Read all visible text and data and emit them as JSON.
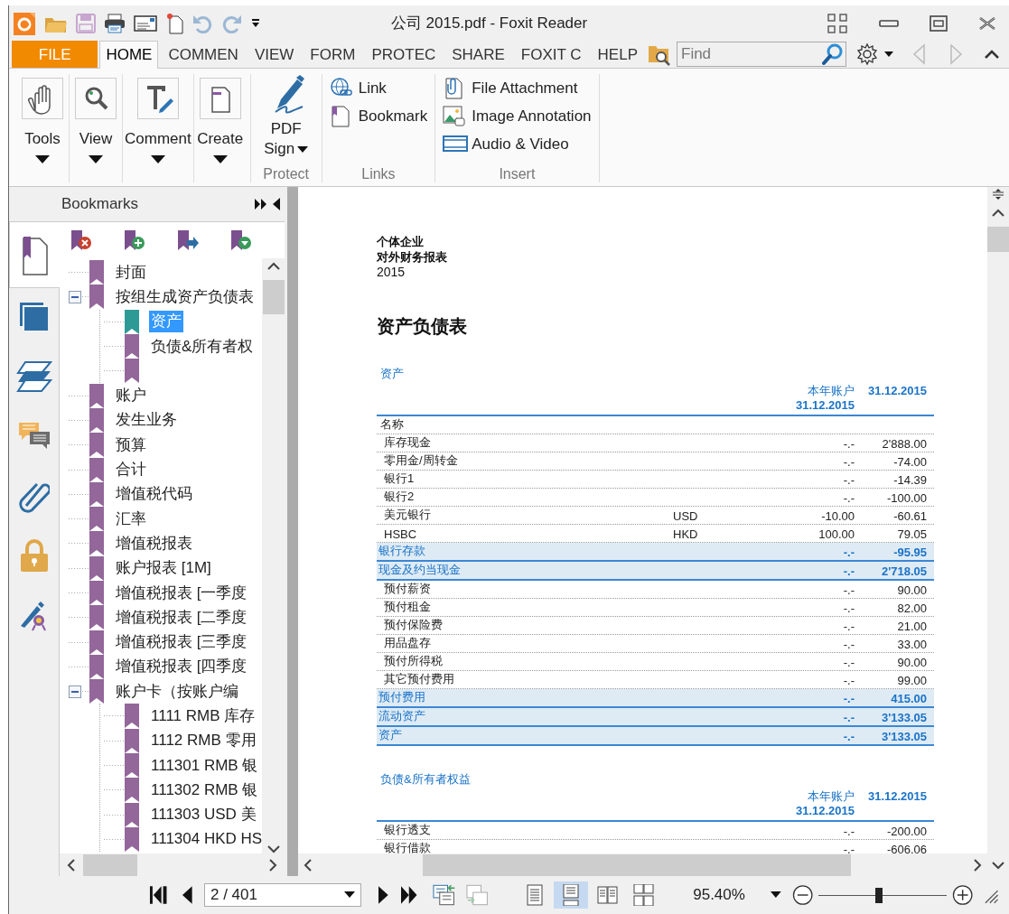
{
  "window": {
    "title": "公司 2015.pdf - Foxit Reader"
  },
  "menu_tabs": [
    {
      "label": "FILE",
      "kind": "file",
      "selected": false
    },
    {
      "label": "HOME",
      "kind": "tab",
      "selected": true
    },
    {
      "label": "COMMEN",
      "kind": "tab",
      "selected": false
    },
    {
      "label": "VIEW",
      "kind": "tab",
      "selected": false
    },
    {
      "label": "FORM",
      "kind": "tab",
      "selected": false
    },
    {
      "label": "PROTEC",
      "kind": "tab",
      "selected": false
    },
    {
      "label": "SHARE",
      "kind": "tab",
      "selected": false
    },
    {
      "label": "FOXIT C",
      "kind": "tab",
      "selected": false
    },
    {
      "label": "HELP",
      "kind": "tab",
      "selected": false
    }
  ],
  "find": {
    "placeholder": "Find"
  },
  "ribbon": [
    {
      "kind": "large",
      "buttons": [
        {
          "label": "Tools"
        },
        {
          "label": "View"
        },
        {
          "label": "Comment"
        },
        {
          "label": "Create"
        }
      ]
    },
    {
      "kind": "sign",
      "label": "Protect",
      "buttons": [
        {
          "label": "PDF Sign"
        }
      ]
    },
    {
      "kind": "list",
      "label": "Links",
      "buttons": [
        {
          "label": "Link"
        },
        {
          "label": "Bookmark"
        }
      ]
    },
    {
      "kind": "list",
      "label": "Insert",
      "buttons": [
        {
          "label": "File Attachment"
        },
        {
          "label": "Image Annotation"
        },
        {
          "label": "Audio & Video"
        }
      ]
    }
  ],
  "sidebar": {
    "title": "Bookmarks",
    "panel_tabs": [
      {
        "kind": "bookmarks",
        "selected": true
      },
      {
        "kind": "pages",
        "selected": false
      },
      {
        "kind": "layers",
        "selected": false
      },
      {
        "kind": "comments",
        "selected": false
      },
      {
        "kind": "attachments",
        "selected": false
      },
      {
        "kind": "security",
        "selected": false
      },
      {
        "kind": "signatures",
        "selected": false
      }
    ],
    "bookmarks": [
      {
        "label": "封面",
        "selected": false
      },
      {
        "label": "按组生成资产负债表",
        "selected": false,
        "expanded": true,
        "children": [
          {
            "label": "资产",
            "selected": true
          },
          {
            "label": "负债&所有者权",
            "selected": false
          },
          {
            "selected": false
          }
        ]
      },
      {
        "label": "账户",
        "selected": false
      },
      {
        "label": "发生业务",
        "selected": false
      },
      {
        "label": "预算",
        "selected": false
      },
      {
        "label": "合计",
        "selected": false
      },
      {
        "label": "增值税代码",
        "selected": false
      },
      {
        "label": "汇率",
        "selected": false
      },
      {
        "label": "增值税报表",
        "selected": false
      },
      {
        "label": "账户报表 [1M]",
        "selected": false
      },
      {
        "label": "增值税报表 [一季度",
        "selected": false
      },
      {
        "label": "增值税报表 [二季度",
        "selected": false
      },
      {
        "label": "增值税报表 [三季度",
        "selected": false
      },
      {
        "label": "增值税报表 [四季度",
        "selected": false
      },
      {
        "label": "账户卡（按账户编",
        "selected": false,
        "expanded": true,
        "children": [
          {
            "label": "1111 RMB 库存",
            "selected": false
          },
          {
            "label": "1112 RMB 零用",
            "selected": false
          },
          {
            "label": "111301 RMB 银",
            "selected": false
          },
          {
            "label": "111302 RMB 银",
            "selected": false
          },
          {
            "label": "111303 USD 美",
            "selected": false
          },
          {
            "label": "111304 HKD HS",
            "selected": false
          }
        ]
      }
    ]
  },
  "document": {
    "header_lines": [
      "个体企业",
      "对外财务报表",
      "2015"
    ],
    "title": "资产负债表",
    "sections": [
      {
        "heading": "资产",
        "column_3": "本年账户 **31.12.2015**",
        "column_4": "31.12.2015",
        "rows": [
          {
            "kind": "label",
            "name": "名称"
          },
          {
            "kind": "item",
            "name": "库存现金",
            "prior": "-.-",
            "current": "2'888.00"
          },
          {
            "kind": "item",
            "name": "零用金/周转金",
            "prior": "-.-",
            "current": "-74.00"
          },
          {
            "kind": "item",
            "name": "银行1",
            "prior": "-.-",
            "current": "-14.39"
          },
          {
            "kind": "item",
            "name": "银行2",
            "prior": "-.-",
            "current": "-100.00"
          },
          {
            "kind": "item",
            "name": "美元银行",
            "currency": "USD",
            "prior": "-10.00",
            "current": "-60.61"
          },
          {
            "kind": "item",
            "name": "HSBC",
            "currency": "HKD",
            "prior": "100.00",
            "current": "79.05"
          },
          {
            "kind": "total",
            "name": "银行存款",
            "prior": "-.-",
            "current": "-95.95"
          },
          {
            "kind": "total",
            "name": "现金及约当现金",
            "prior": "-.-",
            "current": "2'718.05"
          },
          {
            "kind": "item",
            "name": "预付薪资",
            "prior": "-.-",
            "current": "90.00"
          },
          {
            "kind": "item",
            "name": "预付租金",
            "prior": "-.-",
            "current": "82.00"
          },
          {
            "kind": "item",
            "name": "预付保险费",
            "prior": "-.-",
            "current": "21.00"
          },
          {
            "kind": "item",
            "name": "用品盘存",
            "prior": "-.-",
            "current": "33.00"
          },
          {
            "kind": "item",
            "name": "预付所得税",
            "prior": "-.-",
            "current": "90.00"
          },
          {
            "kind": "item",
            "name": "其它预付费用",
            "prior": "-.-",
            "current": "99.00"
          },
          {
            "kind": "total",
            "name": "预付费用",
            "prior": "-.-",
            "current": "415.00"
          },
          {
            "kind": "total",
            "name": "流动资产",
            "prior": "-.-",
            "current": "3'133.05"
          },
          {
            "kind": "total",
            "name": "资产",
            "prior": "-.-",
            "current": "3'133.05"
          }
        ]
      },
      {
        "heading": "负债&所有者权益",
        "column_3": "本年账户 **31.12.2015**",
        "column_4": "31.12.2015",
        "rows": [
          {
            "kind": "item",
            "name": "银行透支",
            "prior": "-.-",
            "current": "-200.00"
          },
          {
            "kind": "item",
            "name": "银行借款",
            "prior": "-.-",
            "current": "-606.06"
          }
        ]
      }
    ]
  },
  "status_bar": {
    "page_field": {
      "value": "2 / 401"
    },
    "view_modes": [
      {
        "kind": "single",
        "selected": false
      },
      {
        "kind": "continuous",
        "selected": true
      },
      {
        "kind": "facing",
        "selected": false
      },
      {
        "kind": "cover",
        "selected": false
      }
    ],
    "zoom": {
      "value": "95.40%",
      "level": 0.47
    }
  }
}
